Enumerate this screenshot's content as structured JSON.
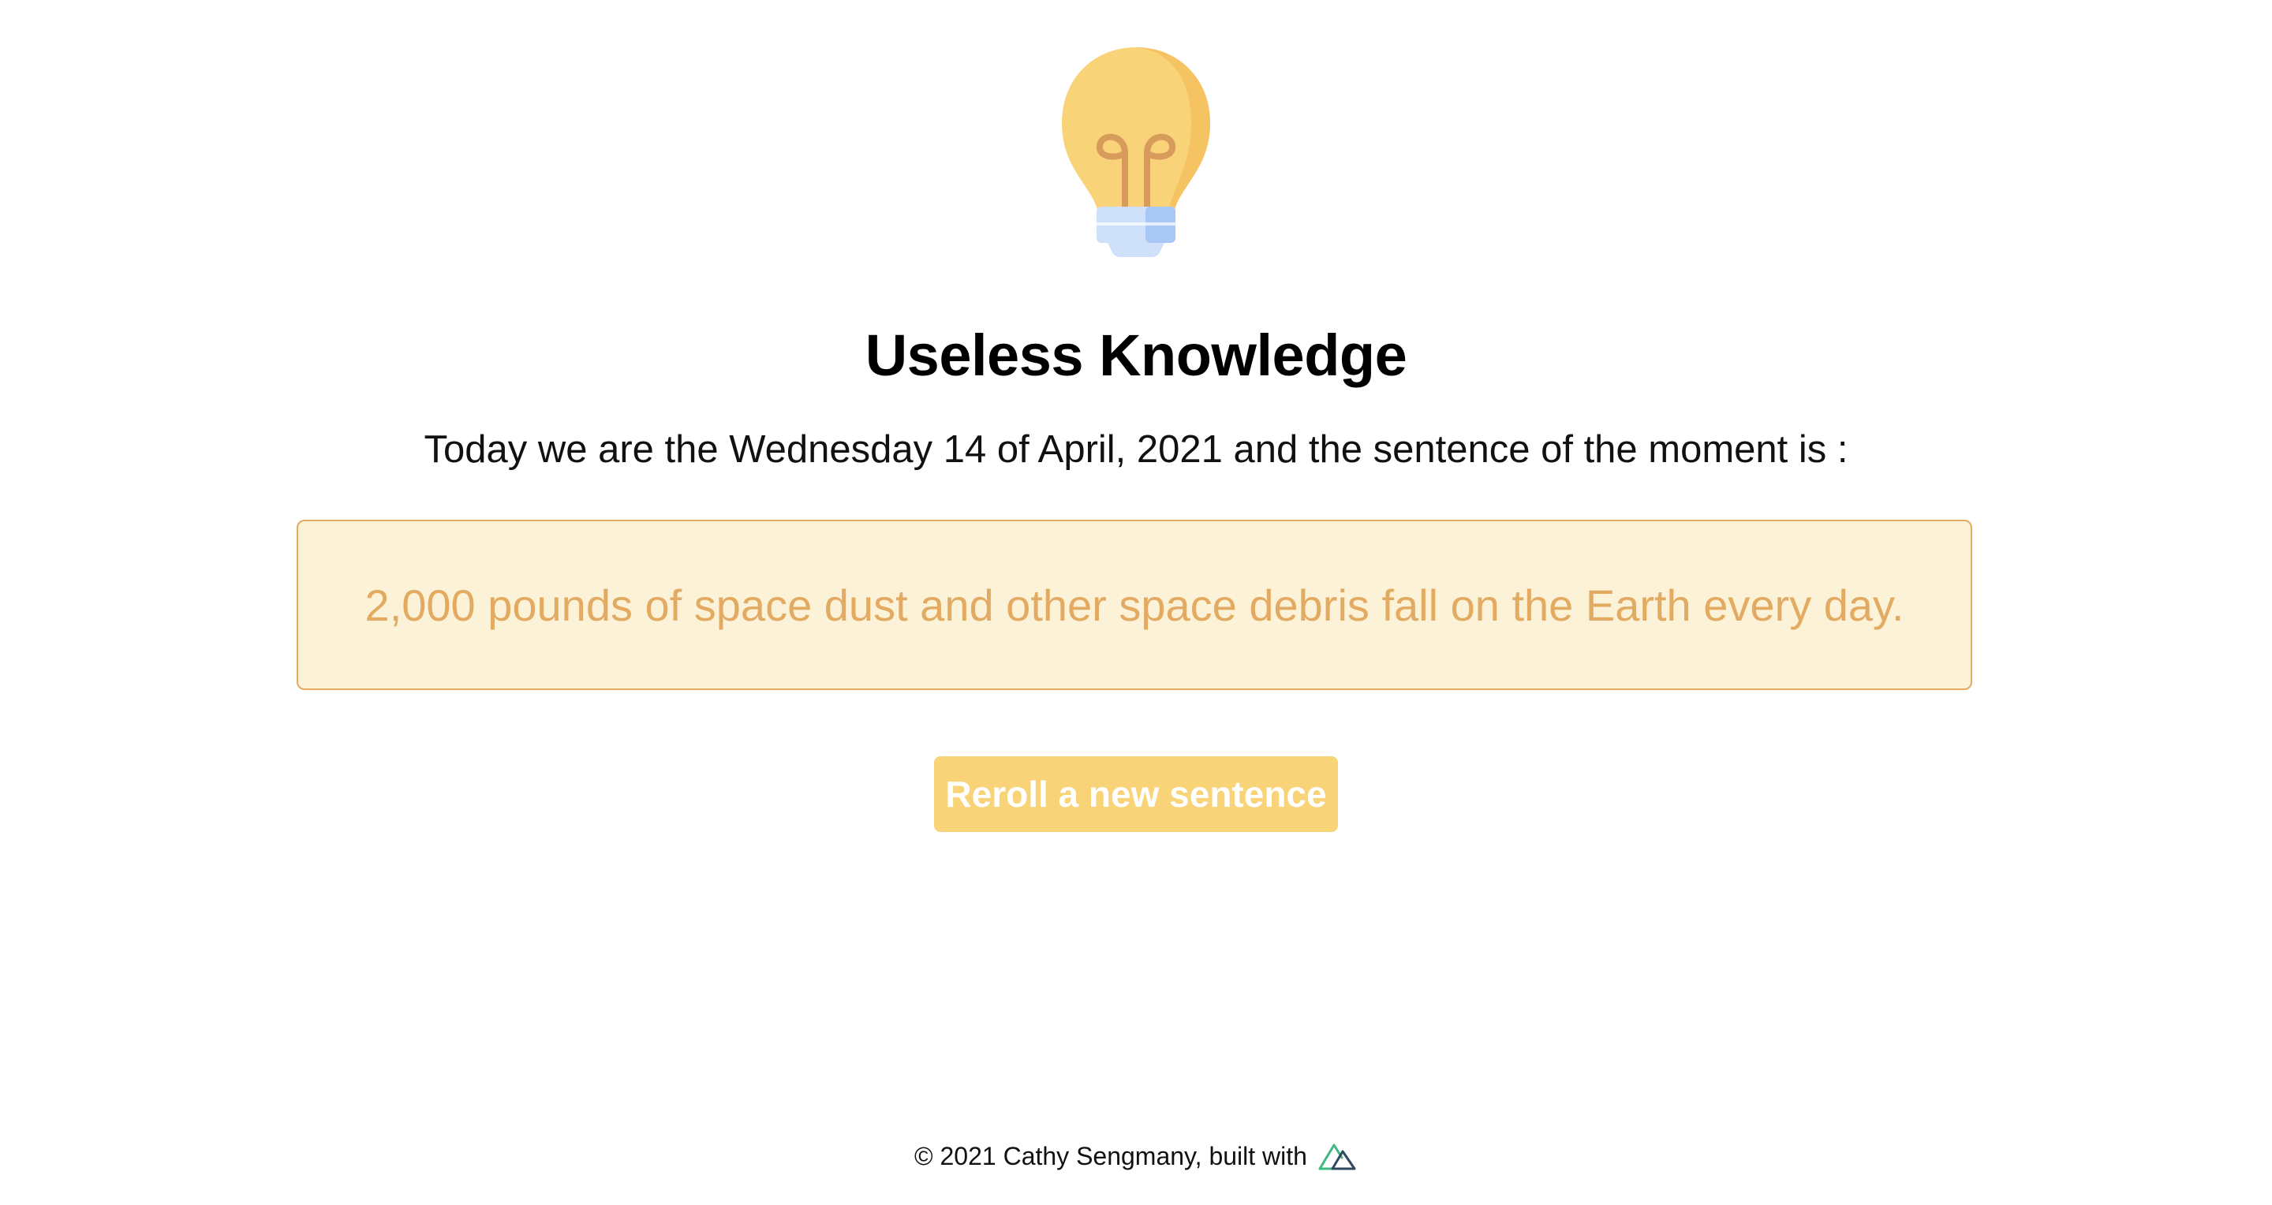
{
  "header": {
    "logo_icon": "light-bulb-icon",
    "title": "Useless Knowledge"
  },
  "main": {
    "intro_text": "Today we are the Wednesday 14 of April, 2021 and the sentence of the moment is :",
    "fact_text": "2,000 pounds of space dust and other space debris fall on the Earth every day.",
    "reroll_label": "Reroll a new sentence"
  },
  "footer": {
    "text": "© 2021 Cathy Sengmany, built with",
    "built_with_icon": "nuxt-logo-icon"
  },
  "colors": {
    "accent": "#f8d377",
    "fact_text": "#e3aa62",
    "fact_background": "#fbf2d8",
    "fact_border": "#e3aa62"
  }
}
